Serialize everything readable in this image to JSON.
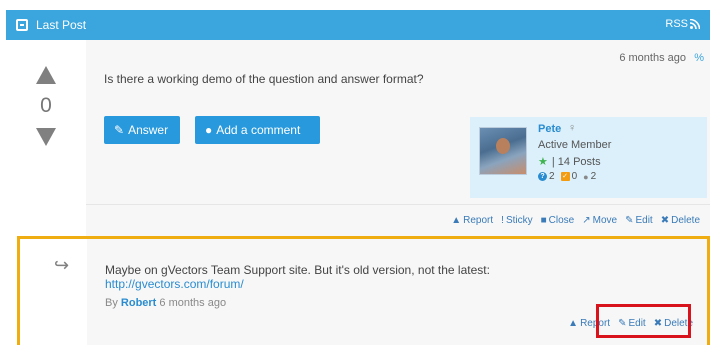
{
  "topbar": {
    "title": "Last Post",
    "rss_label": "RSS",
    "colors": {
      "background": "#3ba5de",
      "text": "#ffffff"
    }
  },
  "post": {
    "votes": "0",
    "date": "6 months  ago",
    "question": "Is there a working demo of the question and answer format?",
    "buttons": {
      "answer": "Answer",
      "add_comment": "Add a comment"
    },
    "author": {
      "name": "Pete",
      "role": "Active Member",
      "posts": "| 14 Posts",
      "stats": {
        "questions": "2",
        "answers": "0",
        "comments": "2"
      }
    },
    "actions": [
      "Report",
      "Sticky",
      "Close",
      "Move",
      "Edit",
      "Delete"
    ]
  },
  "reply": {
    "text": "Maybe on gVectors Team Support site. But it's old version, not the latest:",
    "link": "http://gvectors.com/forum/",
    "by_prefix": "By",
    "author": "Robert",
    "date": "6 months  ago",
    "actions": {
      "report": "Report",
      "edit": "Edit",
      "delete": "Delete"
    },
    "colors": {
      "border": "#f0ad12",
      "highlight": "#d9131c"
    }
  },
  "icons": {
    "topbar": "post-icon",
    "rss": "rss-icon",
    "vote_up": "arrow-up-icon",
    "vote_down": "arrow-down-icon",
    "link": "link-icon",
    "answer": "pencil-icon",
    "comment": "speech-bubble-icon",
    "reply": "reply-arrow-icon"
  }
}
